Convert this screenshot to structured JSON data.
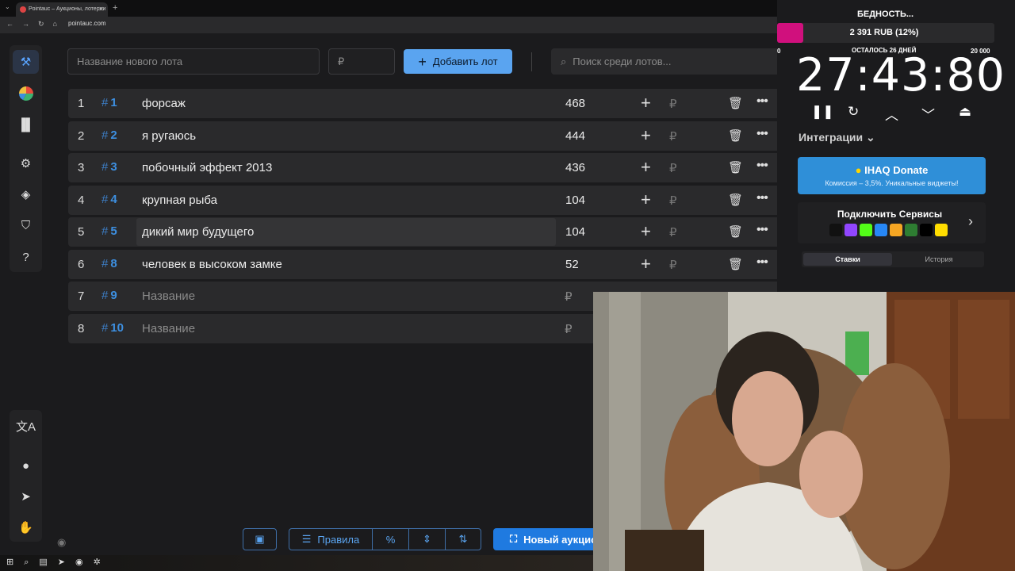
{
  "browser": {
    "tab_title": "Pointauc – Аукционы, лотереи",
    "url": "pointauc.com"
  },
  "form": {
    "lot_name_placeholder": "Название нового лота",
    "price_placeholder": "₽",
    "add_button": "Добавить лот",
    "search_placeholder": "Поиск среди лотов..."
  },
  "lots": [
    {
      "index": "1",
      "id": "1",
      "name": "форсаж",
      "amount": "468"
    },
    {
      "index": "2",
      "id": "2",
      "name": "я ругаюсь",
      "amount": "444"
    },
    {
      "index": "3",
      "id": "3",
      "name": "побочный эффект 2013",
      "amount": "436"
    },
    {
      "index": "4",
      "id": "4",
      "name": "крупная рыба",
      "amount": "104"
    },
    {
      "index": "5",
      "id": "5",
      "name": "дикий мир будущего",
      "amount": "104"
    },
    {
      "index": "6",
      "id": "8",
      "name": "человек в высоком замке",
      "amount": "52"
    },
    {
      "index": "7",
      "id": "9",
      "name": "Название",
      "amount": ""
    },
    {
      "index": "8",
      "id": "10",
      "name": "Название",
      "amount": ""
    }
  ],
  "currency_symbol": "₽",
  "hash": "#",
  "toolbar": {
    "rules": "Правила",
    "new_auction": "Новый аукцион"
  },
  "overlay": {
    "goal_title": "БЕДНОСТЬ...",
    "goal_progress": "2 391 RUB (12%)",
    "goal_fraction": 0.12,
    "goal_min": "0",
    "goal_max": "20 000",
    "days_left": "ОСТАЛОСЬ 26 ДНЕЙ",
    "timer": "27:43:80",
    "integrations": "Интеграции",
    "donate_title": "IHAQ Donate",
    "donate_sub": "Комиссия – 3,5%. Уникальные виджеты!",
    "services_title": "Подключить Сервисы",
    "tab_bids": "Ставки",
    "tab_history": "История"
  },
  "colors": {
    "accent": "#5aa4f0",
    "goal_bar": "#d0107d",
    "background": "#1b1b1d"
  }
}
